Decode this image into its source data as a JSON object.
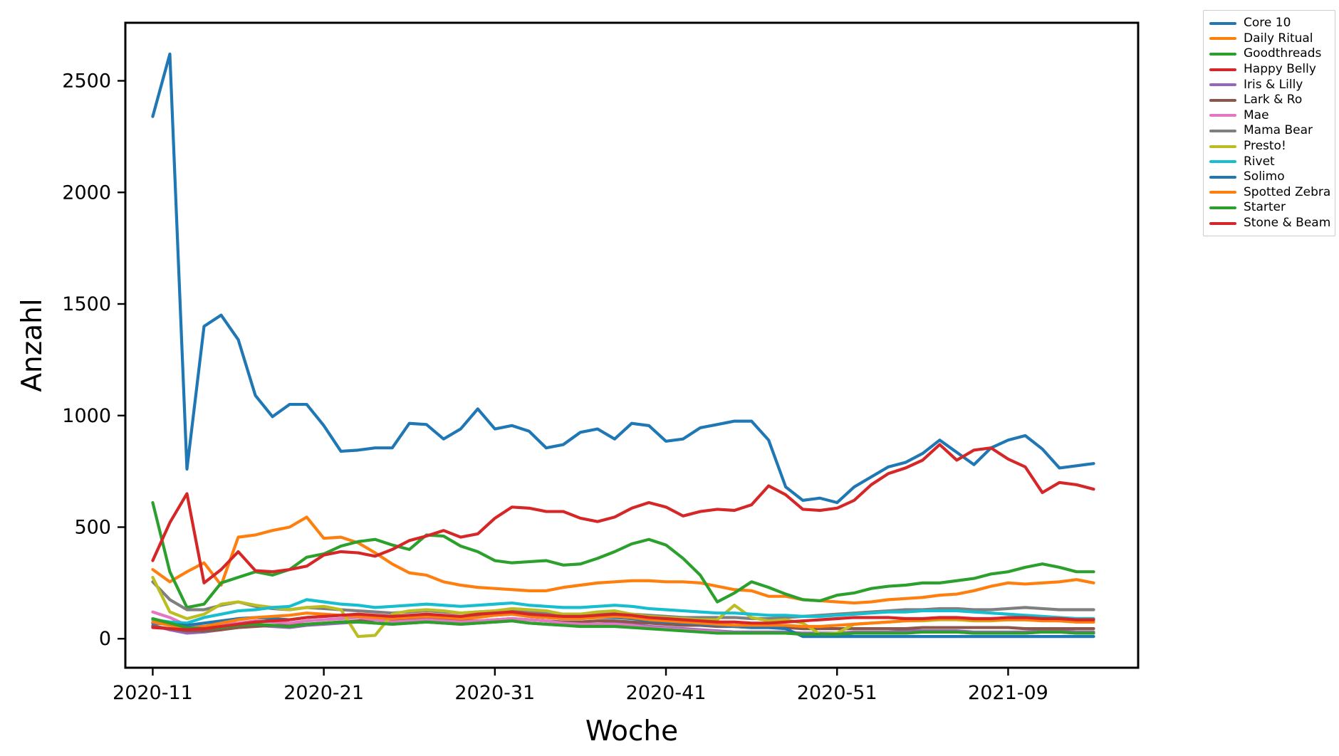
{
  "chart_data": {
    "type": "line",
    "title": "",
    "xlabel": "Woche",
    "ylabel": "Anzahl",
    "ylim": [
      -130,
      2760
    ],
    "yticks": [
      0,
      500,
      1000,
      1500,
      2000,
      2500
    ],
    "ytick_labels": [
      "0",
      "500",
      "1000",
      "1500",
      "2000",
      "2500"
    ],
    "xlim": [
      -1.6,
      57.6
    ],
    "xticks": [
      0,
      10,
      20,
      30,
      40,
      50
    ],
    "xtick_labels": [
      "2020-11",
      "2020-21",
      "2020-31",
      "2020-41",
      "2020-51",
      "2021-09"
    ],
    "grid": false,
    "legend_position": "upper right outside",
    "x": [
      0,
      1,
      2,
      3,
      4,
      5,
      6,
      7,
      8,
      9,
      10,
      11,
      12,
      13,
      14,
      15,
      16,
      17,
      18,
      19,
      20,
      21,
      22,
      23,
      24,
      25,
      26,
      27,
      28,
      29,
      30,
      31,
      32,
      33,
      34,
      35,
      36,
      37,
      38,
      39,
      40,
      41,
      42,
      43,
      44,
      45,
      46,
      47,
      48,
      49,
      50,
      51,
      52,
      53,
      54,
      55
    ],
    "series": [
      {
        "name": "Core 10",
        "color": "#1f77b4",
        "values": [
          2340,
          2620,
          760,
          1400,
          1450,
          1340,
          1090,
          995,
          1050,
          1050,
          955,
          840,
          845,
          855,
          855,
          965,
          960,
          895,
          940,
          1030,
          940,
          955,
          930,
          855,
          870,
          925,
          940,
          895,
          965,
          955,
          885,
          895,
          945,
          960,
          975,
          975,
          890,
          680,
          620,
          630,
          610,
          680,
          725,
          770,
          790,
          830,
          890,
          835,
          780,
          855,
          890,
          910,
          850,
          765,
          775,
          785,
          775
        ]
      },
      {
        "name": "Daily Ritual",
        "color": "#ff7f0e",
        "values": [
          310,
          255,
          300,
          340,
          240,
          455,
          465,
          485,
          500,
          545,
          450,
          455,
          430,
          385,
          335,
          295,
          285,
          255,
          240,
          230,
          225,
          220,
          215,
          215,
          230,
          240,
          250,
          255,
          260,
          260,
          255,
          255,
          250,
          235,
          220,
          215,
          190,
          190,
          175,
          170,
          165,
          160,
          165,
          175,
          180,
          185,
          195,
          200,
          215,
          235,
          250,
          245,
          250,
          255,
          265,
          250
        ]
      },
      {
        "name": "Goodthreads",
        "color": "#2ca02c",
        "values": [
          610,
          300,
          140,
          155,
          250,
          275,
          300,
          285,
          310,
          365,
          380,
          415,
          435,
          445,
          420,
          400,
          465,
          460,
          415,
          390,
          350,
          340,
          345,
          350,
          330,
          335,
          360,
          390,
          425,
          445,
          420,
          360,
          285,
          165,
          205,
          255,
          230,
          200,
          175,
          170,
          195,
          205,
          225,
          235,
          240,
          250,
          250,
          260,
          270,
          290,
          300,
          320,
          335,
          320,
          300,
          300
        ]
      },
      {
        "name": "Happy Belly",
        "color": "#d62728",
        "values": [
          350,
          520,
          650,
          250,
          310,
          390,
          305,
          300,
          310,
          325,
          375,
          390,
          385,
          370,
          400,
          440,
          460,
          485,
          455,
          470,
          540,
          590,
          585,
          570,
          570,
          540,
          525,
          545,
          585,
          610,
          590,
          550,
          570,
          580,
          575,
          600,
          685,
          645,
          580,
          575,
          585,
          620,
          690,
          740,
          765,
          800,
          870,
          800,
          845,
          855,
          805,
          770,
          655,
          700,
          690,
          670
        ]
      },
      {
        "name": "Iris & Lilly",
        "color": "#9467bd",
        "values": [
          60,
          40,
          25,
          30,
          40,
          55,
          60,
          55,
          50,
          60,
          65,
          70,
          75,
          70,
          65,
          70,
          75,
          70,
          65,
          70,
          75,
          80,
          70,
          65,
          60,
          60,
          65,
          70,
          65,
          55,
          50,
          45,
          40,
          35,
          30,
          30,
          30,
          30,
          25,
          25,
          25,
          30,
          30,
          30,
          35,
          35,
          35,
          35,
          30,
          30,
          30,
          30,
          35,
          35,
          30,
          30
        ]
      },
      {
        "name": "Lark & Ro",
        "color": "#8c564b",
        "values": [
          55,
          45,
          35,
          35,
          40,
          50,
          55,
          60,
          60,
          65,
          70,
          75,
          80,
          85,
          85,
          90,
          90,
          85,
          80,
          80,
          85,
          90,
          85,
          80,
          75,
          75,
          80,
          80,
          75,
          70,
          65,
          60,
          60,
          55,
          55,
          50,
          50,
          50,
          45,
          45,
          45,
          45,
          45,
          45,
          45,
          50,
          50,
          50,
          50,
          50,
          50,
          45,
          45,
          45,
          45,
          45
        ]
      },
      {
        "name": "Mae",
        "color": "#e377c2",
        "values": [
          120,
          95,
          60,
          55,
          65,
          70,
          80,
          75,
          70,
          80,
          85,
          90,
          95,
          85,
          75,
          80,
          85,
          80,
          75,
          80,
          85,
          90,
          85,
          80,
          70,
          65,
          65,
          65,
          60,
          50,
          45,
          40,
          35,
          30,
          25,
          25,
          25,
          25,
          20,
          20,
          20,
          25,
          25,
          25,
          25,
          30,
          30,
          30,
          25,
          25,
          25,
          25,
          30,
          30,
          25,
          25
        ]
      },
      {
        "name": "Mama Bear",
        "color": "#7f7f7f",
        "values": [
          255,
          175,
          130,
          130,
          150,
          165,
          145,
          135,
          130,
          140,
          135,
          130,
          125,
          120,
          115,
          120,
          125,
          120,
          115,
          120,
          125,
          130,
          120,
          115,
          110,
          110,
          115,
          115,
          110,
          105,
          100,
          95,
          95,
          95,
          95,
          90,
          90,
          95,
          100,
          105,
          110,
          115,
          120,
          125,
          130,
          130,
          135,
          135,
          130,
          130,
          135,
          140,
          135,
          130,
          130,
          130
        ]
      },
      {
        "name": "Presto!",
        "color": "#bcbd22",
        "values": [
          275,
          120,
          90,
          110,
          155,
          165,
          150,
          140,
          130,
          140,
          145,
          130,
          10,
          15,
          110,
          125,
          130,
          125,
          115,
          120,
          125,
          135,
          130,
          125,
          110,
          110,
          120,
          125,
          110,
          100,
          95,
          90,
          85,
          85,
          150,
          95,
          80,
          85,
          70,
          20,
          25,
          65,
          70,
          75,
          80,
          80,
          85,
          85,
          80,
          80,
          85,
          85,
          85,
          80,
          75,
          75
        ]
      },
      {
        "name": "Rivet",
        "color": "#17becf",
        "values": [
          85,
          75,
          70,
          95,
          110,
          125,
          130,
          140,
          145,
          175,
          165,
          155,
          150,
          140,
          145,
          150,
          155,
          150,
          145,
          150,
          155,
          160,
          150,
          145,
          140,
          140,
          145,
          150,
          145,
          135,
          130,
          125,
          120,
          115,
          115,
          110,
          105,
          105,
          100,
          100,
          105,
          110,
          115,
          120,
          120,
          125,
          125,
          125,
          120,
          115,
          110,
          105,
          100,
          95,
          90,
          90
        ]
      },
      {
        "name": "Solimo",
        "color": "#1f77b4",
        "values": [
          70,
          65,
          60,
          70,
          80,
          90,
          95,
          90,
          85,
          95,
          100,
          105,
          105,
          100,
          95,
          100,
          105,
          100,
          95,
          100,
          105,
          110,
          100,
          95,
          90,
          90,
          95,
          95,
          90,
          80,
          75,
          70,
          65,
          60,
          55,
          50,
          50,
          45,
          10,
          10,
          10,
          10,
          10,
          10,
          10,
          10,
          10,
          10,
          10,
          10,
          10,
          10,
          10,
          10,
          10,
          10
        ]
      },
      {
        "name": "Spotted Zebra",
        "color": "#ff7f0e",
        "values": [
          75,
          60,
          45,
          55,
          70,
          85,
          95,
          100,
          105,
          115,
          110,
          105,
          100,
          95,
          90,
          95,
          100,
          95,
          90,
          95,
          105,
          110,
          100,
          95,
          90,
          90,
          95,
          100,
          95,
          85,
          80,
          75,
          70,
          65,
          60,
          60,
          60,
          60,
          55,
          55,
          60,
          65,
          70,
          75,
          80,
          85,
          90,
          90,
          85,
          85,
          85,
          85,
          80,
          80,
          75,
          75
        ]
      },
      {
        "name": "Starter",
        "color": "#2ca02c",
        "values": [
          90,
          70,
          50,
          45,
          50,
          60,
          65,
          60,
          55,
          65,
          70,
          75,
          75,
          70,
          65,
          70,
          75,
          70,
          65,
          70,
          75,
          80,
          70,
          65,
          60,
          55,
          55,
          55,
          50,
          45,
          40,
          35,
          30,
          25,
          25,
          25,
          25,
          25,
          20,
          20,
          20,
          25,
          25,
          25,
          25,
          30,
          30,
          30,
          25,
          25,
          25,
          25,
          30,
          30,
          25,
          25
        ]
      },
      {
        "name": "Stone & Beam",
        "color": "#d62728",
        "values": [
          50,
          45,
          40,
          45,
          55,
          65,
          75,
          80,
          85,
          95,
          100,
          105,
          110,
          105,
          100,
          105,
          110,
          105,
          100,
          110,
          115,
          120,
          110,
          105,
          100,
          100,
          105,
          110,
          105,
          95,
          90,
          85,
          80,
          75,
          75,
          70,
          70,
          75,
          80,
          85,
          90,
          95,
          95,
          95,
          90,
          90,
          95,
          95,
          90,
          90,
          95,
          95,
          90,
          90,
          85,
          85
        ]
      }
    ]
  },
  "legend": {
    "items": [
      {
        "label": "Core 10",
        "color": "#1f77b4"
      },
      {
        "label": "Daily Ritual",
        "color": "#ff7f0e"
      },
      {
        "label": "Goodthreads",
        "color": "#2ca02c"
      },
      {
        "label": "Happy Belly",
        "color": "#d62728"
      },
      {
        "label": "Iris & Lilly",
        "color": "#9467bd"
      },
      {
        "label": "Lark & Ro",
        "color": "#8c564b"
      },
      {
        "label": "Mae",
        "color": "#e377c2"
      },
      {
        "label": "Mama Bear",
        "color": "#7f7f7f"
      },
      {
        "label": "Presto!",
        "color": "#bcbd22"
      },
      {
        "label": "Rivet",
        "color": "#17becf"
      },
      {
        "label": "Solimo",
        "color": "#1f77b4"
      },
      {
        "label": "Spotted Zebra",
        "color": "#ff7f0e"
      },
      {
        "label": "Starter",
        "color": "#2ca02c"
      },
      {
        "label": "Stone & Beam",
        "color": "#d62728"
      }
    ]
  }
}
